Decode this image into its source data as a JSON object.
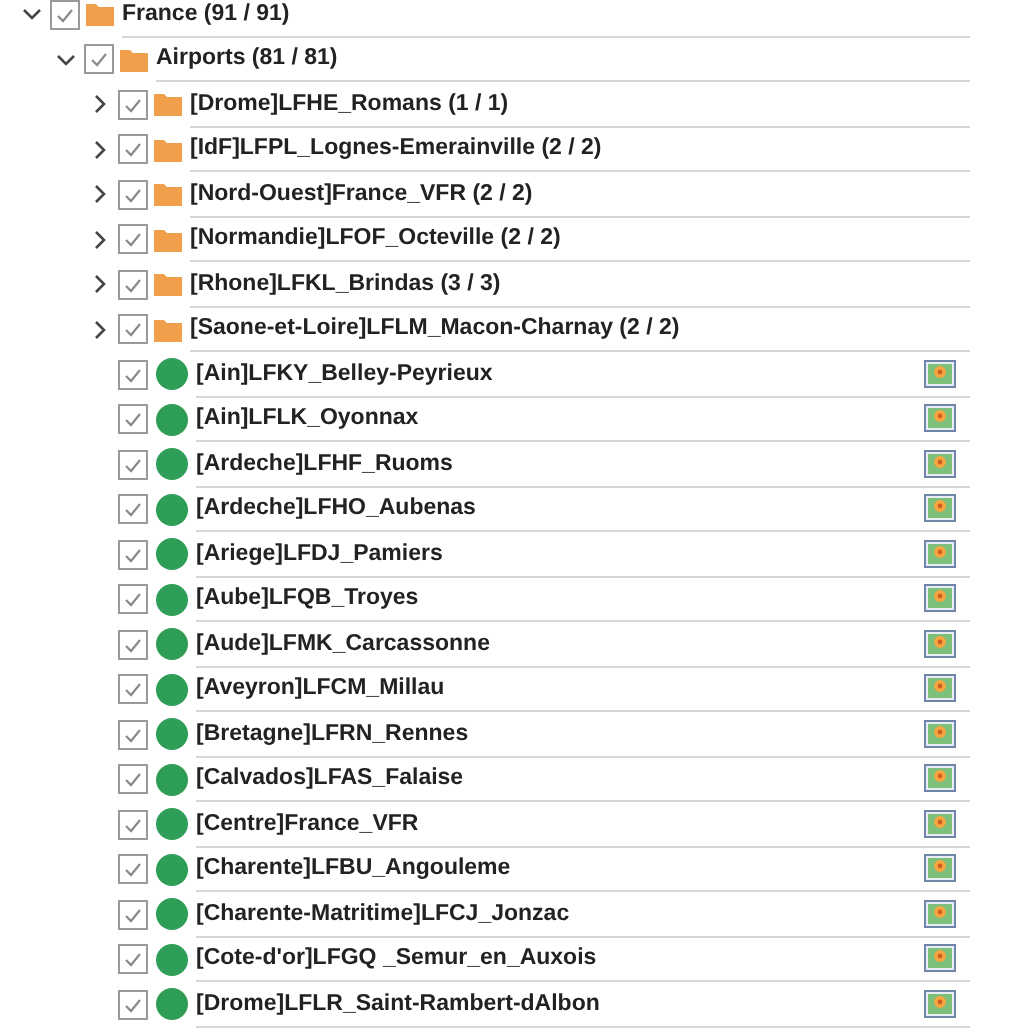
{
  "tree": [
    {
      "kind": "folder",
      "label": "France (91 / 91)",
      "expanded": true,
      "checked": true,
      "children": [
        {
          "kind": "folder",
          "label": "Airports (81 / 81)",
          "expanded": true,
          "checked": true,
          "children": [
            {
              "kind": "folder",
              "label": "[Drome]LFHE_Romans (1 / 1)",
              "expanded": false,
              "checked": true
            },
            {
              "kind": "folder",
              "label": "[IdF]LFPL_Lognes-Emerainville (2 / 2)",
              "expanded": false,
              "checked": true
            },
            {
              "kind": "folder",
              "label": "[Nord-Ouest]France_VFR (2 / 2)",
              "expanded": false,
              "checked": true
            },
            {
              "kind": "folder",
              "label": "[Normandie]LFOF_Octeville (2 / 2)",
              "expanded": false,
              "checked": true
            },
            {
              "kind": "folder",
              "label": "[Rhone]LFKL_Brindas (3 / 3)",
              "expanded": false,
              "checked": true
            },
            {
              "kind": "folder",
              "label": "[Saone-et-Loire]LFLM_Macon-Charnay (2 / 2)",
              "expanded": false,
              "checked": true
            },
            {
              "kind": "place",
              "label": "[Ain]LFKY_Belley-Peyrieux",
              "checked": true
            },
            {
              "kind": "place",
              "label": "[Ain]LFLK_Oyonnax",
              "checked": true
            },
            {
              "kind": "place",
              "label": "[Ardeche]LFHF_Ruoms",
              "checked": true
            },
            {
              "kind": "place",
              "label": "[Ardeche]LFHO_Aubenas",
              "checked": true
            },
            {
              "kind": "place",
              "label": "[Ariege]LFDJ_Pamiers",
              "checked": true
            },
            {
              "kind": "place",
              "label": "[Aube]LFQB_Troyes",
              "checked": true
            },
            {
              "kind": "place",
              "label": "[Aude]LFMK_Carcassonne",
              "checked": true
            },
            {
              "kind": "place",
              "label": "[Aveyron]LFCM_Millau",
              "checked": true
            },
            {
              "kind": "place",
              "label": "[Bretagne]LFRN_Rennes",
              "checked": true
            },
            {
              "kind": "place",
              "label": "[Calvados]LFAS_Falaise",
              "checked": true
            },
            {
              "kind": "place",
              "label": "[Centre]France_VFR",
              "checked": true
            },
            {
              "kind": "place",
              "label": "[Charente]LFBU_Angouleme",
              "checked": true
            },
            {
              "kind": "place",
              "label": "[Charente-Matritime]LFCJ_Jonzac",
              "checked": true
            },
            {
              "kind": "place",
              "label": "[Cote-d'or]LFGQ _Semur_en_Auxois",
              "checked": true
            },
            {
              "kind": "place",
              "label": "[Drome]LFLR_Saint-Rambert-dAlbon",
              "checked": true
            }
          ]
        }
      ]
    }
  ]
}
